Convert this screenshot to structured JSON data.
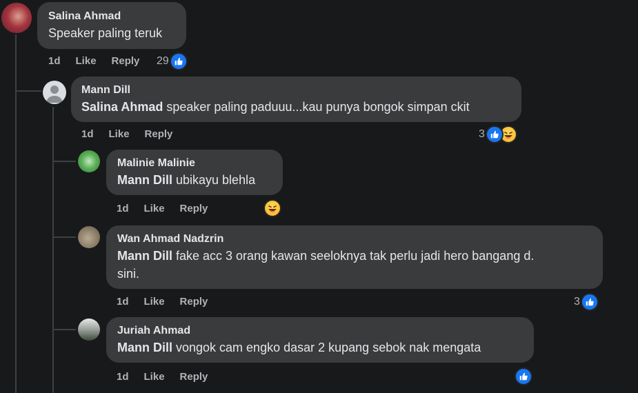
{
  "comments": [
    {
      "author": "Salina Ahmad",
      "mention": "",
      "text": "Speaker paling teruk",
      "time": "1d",
      "like_label": "Like",
      "reply_label": "Reply",
      "reaction_count": "29",
      "reactions": [
        "like-icon"
      ]
    },
    {
      "author": "Mann Dill",
      "mention": "Salina Ahmad",
      "text": " speaker paling paduuu...kau punya bongok simpan ckit",
      "time": "1d",
      "like_label": "Like",
      "reply_label": "Reply",
      "reaction_count": "3",
      "reactions": [
        "like-icon",
        "haha-icon"
      ]
    },
    {
      "author": "Malinie Malinie",
      "mention": "Mann Dill",
      "text": " ubikayu blehla",
      "time": "1d",
      "like_label": "Like",
      "reply_label": "Reply",
      "reaction_count": "",
      "reactions": [
        "haha-icon"
      ]
    },
    {
      "author": "Wan Ahmad Nadzrin",
      "mention": "Mann Dill",
      "text": " fake acc 3 orang kawan seeloknya tak perlu jadi hero bangang d.",
      "text_line2": "sini.",
      "time": "1d",
      "like_label": "Like",
      "reply_label": "Reply",
      "reaction_count": "3",
      "reactions": [
        "like-icon"
      ]
    },
    {
      "author": "Juriah Ahmad",
      "mention": "Mann Dill",
      "text": " vongok cam engko dasar 2 kupang sebok nak mengata",
      "time": "1d",
      "like_label": "Like",
      "reply_label": "Reply",
      "reaction_count": "",
      "reactions": [
        "like-icon"
      ]
    }
  ],
  "colors": {
    "background": "#18191a",
    "bubble": "#3a3b3c",
    "like_blue": "#1877f2",
    "muted_text": "#b0b3b8"
  }
}
